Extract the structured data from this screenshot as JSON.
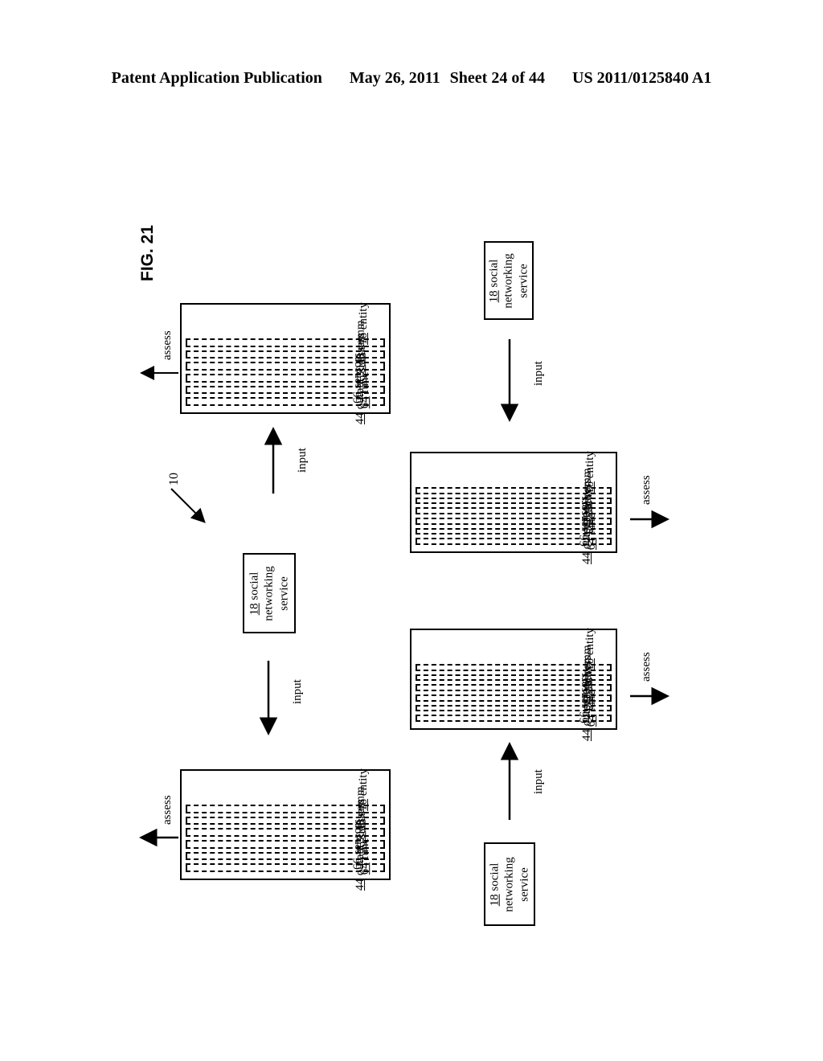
{
  "header": {
    "publication": "Patent Application Publication",
    "date": "May 26, 2011",
    "sheet": "Sheet 24 of 44",
    "patent_number": "US 2011/0125840 A1"
  },
  "figure": {
    "label": "FIG. 21",
    "reference_numeral": "10"
  },
  "entity": {
    "title_num": "16",
    "title_text": "entity",
    "components": [
      {
        "num": "40",
        "text": "comm"
      },
      {
        "num": "30",
        "text": "assess"
      },
      {
        "num": "56",
        "text": "status"
      },
      {
        "num": "66",
        "text": "sensors"
      },
      {
        "num": "64",
        "text": "func"
      },
      {
        "num": "44",
        "text": "output"
      }
    ]
  },
  "social_service": {
    "num": "18",
    "line1": "social",
    "line2": "networking",
    "line3": "service"
  },
  "labels": {
    "input": "input",
    "assess": "assess"
  },
  "nodes": {
    "entity_top_left": {
      "name": "entity-top-left"
    },
    "entity_middle_right": {
      "name": "entity-middle-right"
    },
    "entity_lower_right": {
      "name": "entity-lower-right"
    },
    "entity_bottom_left": {
      "name": "entity-bottom-left"
    },
    "sns_top_right": {
      "name": "social-networking-service-top-right"
    },
    "sns_center": {
      "name": "social-networking-service-center"
    },
    "sns_bottom": {
      "name": "social-networking-service-bottom"
    }
  }
}
